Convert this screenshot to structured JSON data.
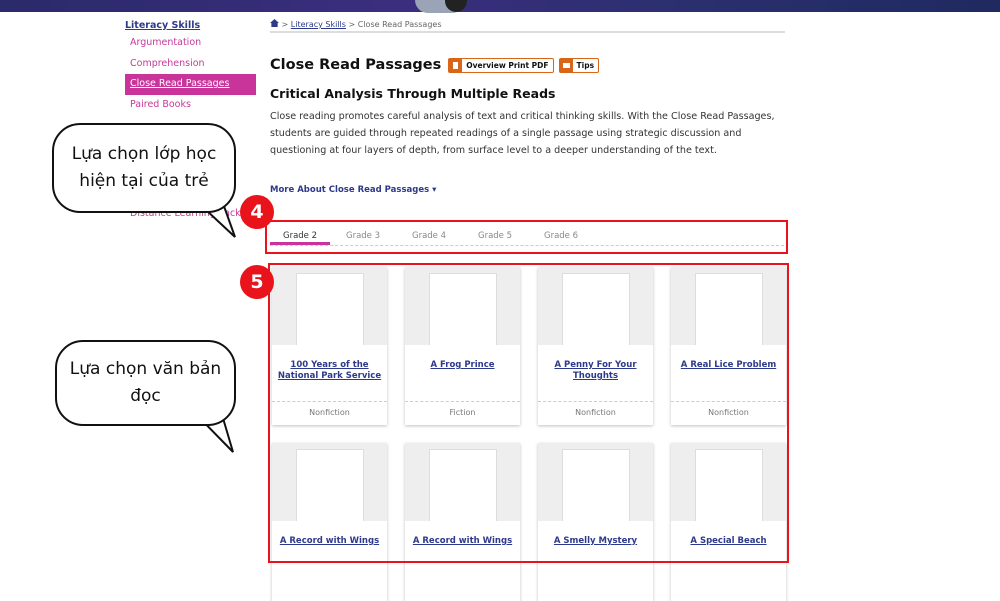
{
  "sidebar": {
    "heading": "Literacy Skills",
    "items": [
      {
        "label": "Argumentation"
      },
      {
        "label": "Comprehension"
      },
      {
        "label": "Close Read Passages",
        "active": true
      },
      {
        "label": "Paired Books"
      },
      {
        "label": "Distance Learning Packs"
      }
    ]
  },
  "breadcrumb": {
    "link": "Literacy Skills",
    "current": "Close Read Passages"
  },
  "page": {
    "title": "Close Read Passages",
    "pdf_button": "Overview Print PDF",
    "tips_button": "Tips",
    "subtitle": "Critical Analysis Through Multiple Reads",
    "description": "Close reading promotes careful analysis of text and critical thinking skills. With the Close Read Passages, students are guided through repeated readings of a single passage using strategic discussion and questioning at four layers of depth, from surface level to a deeper understanding of the text.",
    "more_link": "More About Close Read Passages ▾"
  },
  "tabs": [
    {
      "label": "Grade 2",
      "active": true
    },
    {
      "label": "Grade 3"
    },
    {
      "label": "Grade 4"
    },
    {
      "label": "Grade 5"
    },
    {
      "label": "Grade 6"
    }
  ],
  "cards": [
    {
      "title": "100 Years of the National Park Service",
      "genre": "Nonfiction"
    },
    {
      "title": "A Frog Prince",
      "genre": "Fiction"
    },
    {
      "title": "A Penny For Your Thoughts",
      "genre": "Nonfiction"
    },
    {
      "title": "A Real Lice Problem",
      "genre": "Nonfiction"
    },
    {
      "title": "A Record with Wings",
      "genre": ""
    },
    {
      "title": "A Record with Wings",
      "genre": ""
    },
    {
      "title": "A Smelly Mystery",
      "genre": ""
    },
    {
      "title": "A Special Beach",
      "genre": ""
    }
  ],
  "annotations": {
    "badge4": "4",
    "badge5": "5",
    "callout1": "Lựa chọn lớp học hiện tại của trẻ",
    "callout2": "Lựa chọn văn bản đọc",
    "highlight_color": "#e8131b"
  }
}
